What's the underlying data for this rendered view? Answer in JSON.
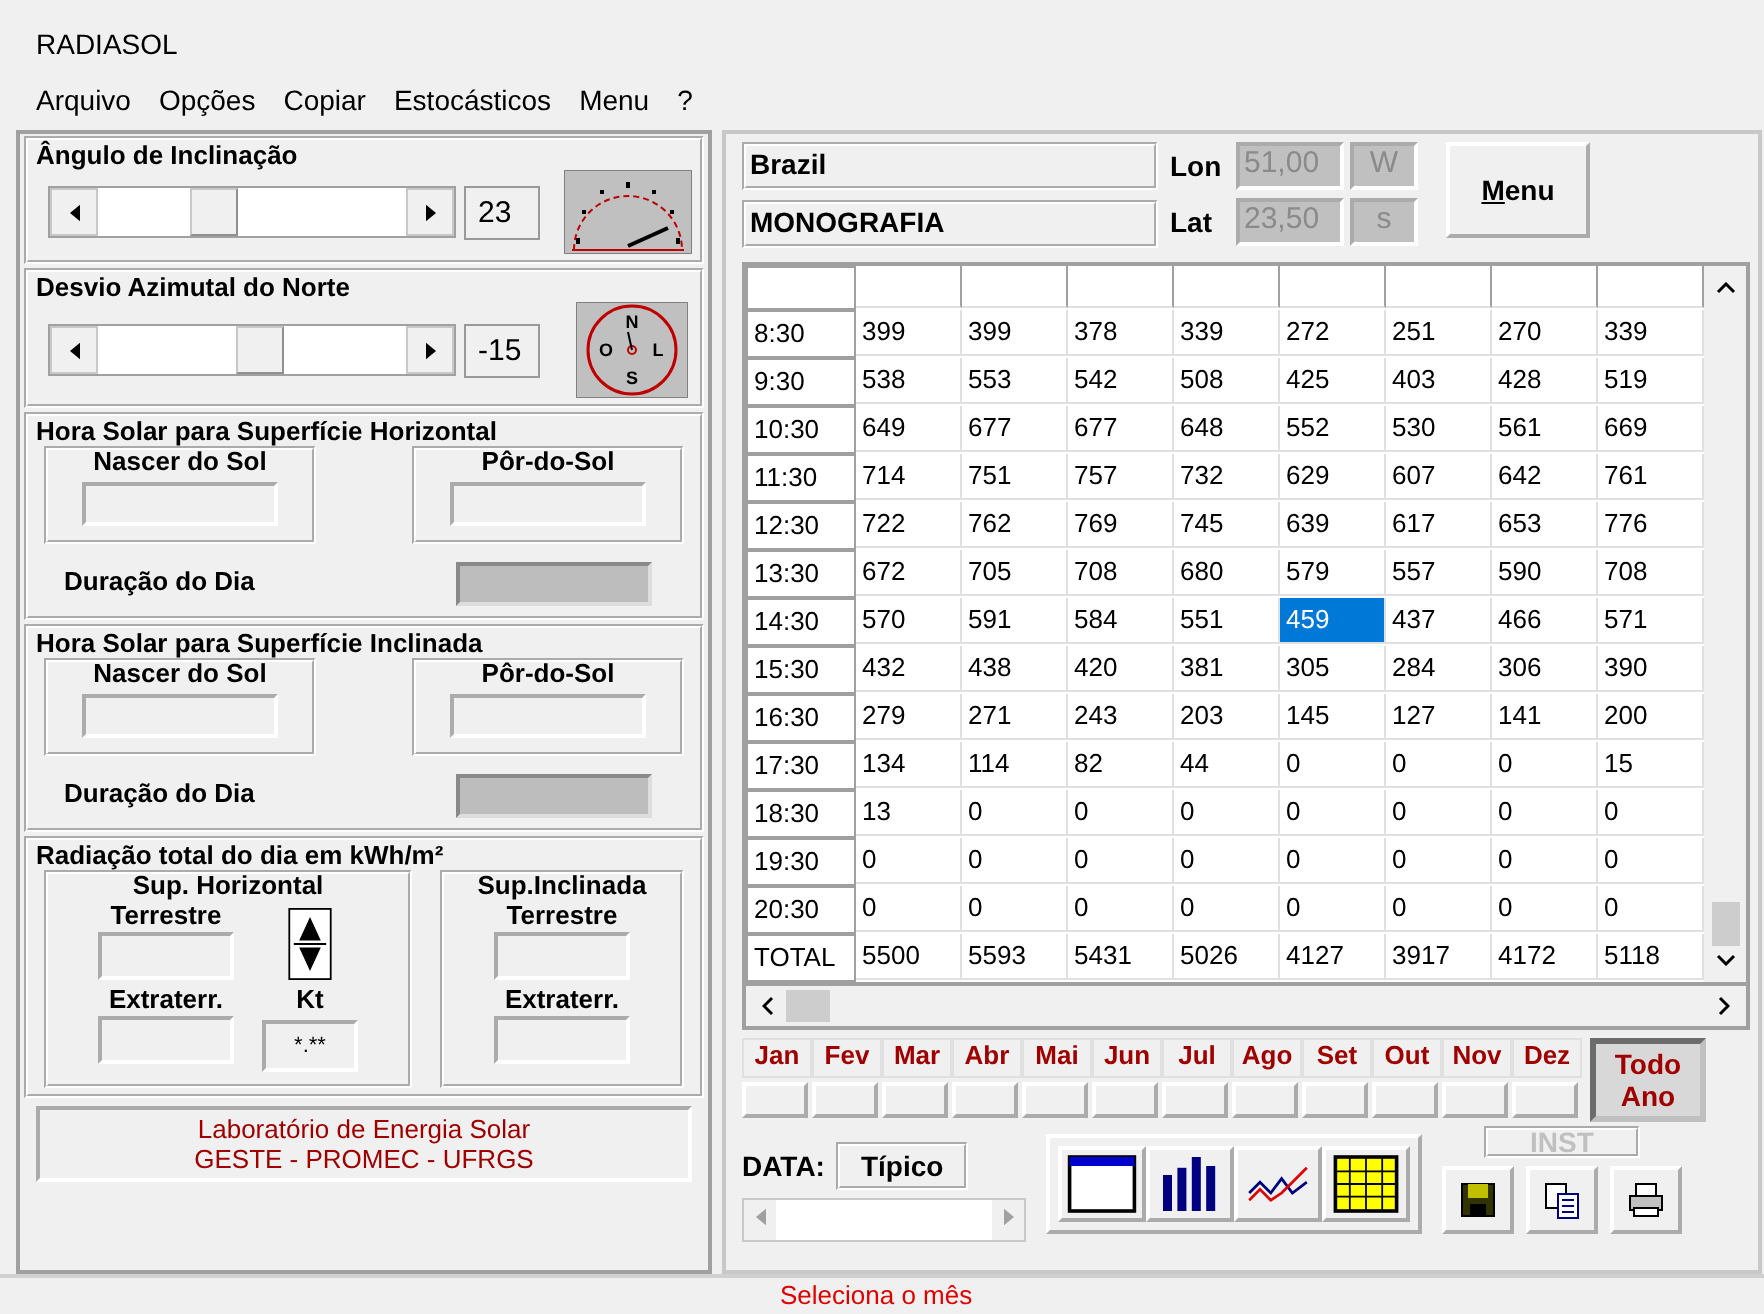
{
  "window": {
    "title": "RADIASOL"
  },
  "menu": [
    "Arquivo",
    "Opções",
    "Copiar",
    "Estocásticos",
    "Menu",
    "?"
  ],
  "tilt": {
    "title": "Ângulo de Inclinação",
    "value": "23"
  },
  "azimuth": {
    "title": "Desvio Azimutal do Norte",
    "value": "-15",
    "compass": [
      "N",
      "L",
      "S",
      "O"
    ]
  },
  "sun_groups": [
    {
      "title": "Hora Solar para Superfície Horizontal",
      "sunrise": "Nascer do Sol",
      "sunset": "Pôr-do-Sol",
      "duration": "Duração do Dia"
    },
    {
      "title": "Hora Solar para Superfície Inclinada",
      "sunrise": "Nascer do Sol",
      "sunset": "Pôr-do-Sol",
      "duration": "Duração do Dia"
    }
  ],
  "radiation": {
    "title": "Radiação total do dia em kWh/m²",
    "horizontal": "Sup. Horizontal",
    "inclined": "Sup.Inclinada",
    "horizontal_terrestrial": "Terrestre",
    "horizontal_extra": "Extraterr.",
    "inclined_terrestrial": "Terrestre",
    "inclined_extra": "Extraterr.",
    "kt_label": "Kt",
    "kt_value": "*.**"
  },
  "footer": [
    "Laboratório de Energia Solar",
    "GESTE - PROMEC - UFRGS"
  ],
  "location": {
    "country": "Brazil",
    "site": "MONOGRAFIA",
    "lon_label": "Lon",
    "lon": "51,00",
    "lon_dir": "W",
    "lat_label": "Lat",
    "lat": "23,50",
    "lat_dir": "s",
    "disabled": true,
    "menu_button": "Menu"
  },
  "table": {
    "rows": [
      {
        "time": "8:30",
        "cells": [
          {
            "v": "399",
            "selected": false
          },
          {
            "v": "399",
            "selected": false
          },
          {
            "v": "378",
            "selected": false
          },
          {
            "v": "339",
            "selected": false
          },
          {
            "v": "272",
            "selected": false
          },
          {
            "v": "251",
            "selected": false
          },
          {
            "v": "270",
            "selected": false
          },
          {
            "v": "339",
            "selected": false
          }
        ]
      },
      {
        "time": "9:30",
        "cells": [
          {
            "v": "538",
            "selected": false
          },
          {
            "v": "553",
            "selected": false
          },
          {
            "v": "542",
            "selected": false
          },
          {
            "v": "508",
            "selected": false
          },
          {
            "v": "425",
            "selected": false
          },
          {
            "v": "403",
            "selected": false
          },
          {
            "v": "428",
            "selected": false
          },
          {
            "v": "519",
            "selected": false
          }
        ]
      },
      {
        "time": "10:30",
        "cells": [
          {
            "v": "649",
            "selected": false
          },
          {
            "v": "677",
            "selected": false
          },
          {
            "v": "677",
            "selected": false
          },
          {
            "v": "648",
            "selected": false
          },
          {
            "v": "552",
            "selected": false
          },
          {
            "v": "530",
            "selected": false
          },
          {
            "v": "561",
            "selected": false
          },
          {
            "v": "669",
            "selected": false
          }
        ]
      },
      {
        "time": "11:30",
        "cells": [
          {
            "v": "714",
            "selected": false
          },
          {
            "v": "751",
            "selected": false
          },
          {
            "v": "757",
            "selected": false
          },
          {
            "v": "732",
            "selected": false
          },
          {
            "v": "629",
            "selected": false
          },
          {
            "v": "607",
            "selected": false
          },
          {
            "v": "642",
            "selected": false
          },
          {
            "v": "761",
            "selected": false
          }
        ]
      },
      {
        "time": "12:30",
        "cells": [
          {
            "v": "722",
            "selected": false
          },
          {
            "v": "762",
            "selected": false
          },
          {
            "v": "769",
            "selected": false
          },
          {
            "v": "745",
            "selected": false
          },
          {
            "v": "639",
            "selected": false
          },
          {
            "v": "617",
            "selected": false
          },
          {
            "v": "653",
            "selected": false
          },
          {
            "v": "776",
            "selected": false
          }
        ]
      },
      {
        "time": "13:30",
        "cells": [
          {
            "v": "672",
            "selected": false
          },
          {
            "v": "705",
            "selected": false
          },
          {
            "v": "708",
            "selected": false
          },
          {
            "v": "680",
            "selected": false
          },
          {
            "v": "579",
            "selected": false
          },
          {
            "v": "557",
            "selected": false
          },
          {
            "v": "590",
            "selected": false
          },
          {
            "v": "708",
            "selected": false
          }
        ]
      },
      {
        "time": "14:30",
        "cells": [
          {
            "v": "570",
            "selected": false
          },
          {
            "v": "591",
            "selected": false
          },
          {
            "v": "584",
            "selected": false
          },
          {
            "v": "551",
            "selected": false
          },
          {
            "v": "459",
            "selected": true
          },
          {
            "v": "437",
            "selected": false
          },
          {
            "v": "466",
            "selected": false
          },
          {
            "v": "571",
            "selected": false
          }
        ]
      },
      {
        "time": "15:30",
        "cells": [
          {
            "v": "432",
            "selected": false
          },
          {
            "v": "438",
            "selected": false
          },
          {
            "v": "420",
            "selected": false
          },
          {
            "v": "381",
            "selected": false
          },
          {
            "v": "305",
            "selected": false
          },
          {
            "v": "284",
            "selected": false
          },
          {
            "v": "306",
            "selected": false
          },
          {
            "v": "390",
            "selected": false
          }
        ]
      },
      {
        "time": "16:30",
        "cells": [
          {
            "v": "279",
            "selected": false
          },
          {
            "v": "271",
            "selected": false
          },
          {
            "v": "243",
            "selected": false
          },
          {
            "v": "203",
            "selected": false
          },
          {
            "v": "145",
            "selected": false
          },
          {
            "v": "127",
            "selected": false
          },
          {
            "v": "141",
            "selected": false
          },
          {
            "v": "200",
            "selected": false
          }
        ]
      },
      {
        "time": "17:30",
        "cells": [
          {
            "v": "134",
            "selected": false
          },
          {
            "v": "114",
            "selected": false
          },
          {
            "v": "82",
            "selected": false
          },
          {
            "v": "44",
            "selected": false
          },
          {
            "v": "0",
            "selected": false
          },
          {
            "v": "0",
            "selected": false
          },
          {
            "v": "0",
            "selected": false
          },
          {
            "v": "15",
            "selected": false
          }
        ]
      },
      {
        "time": "18:30",
        "cells": [
          {
            "v": "13",
            "selected": false
          },
          {
            "v": "0",
            "selected": false
          },
          {
            "v": "0",
            "selected": false
          },
          {
            "v": "0",
            "selected": false
          },
          {
            "v": "0",
            "selected": false
          },
          {
            "v": "0",
            "selected": false
          },
          {
            "v": "0",
            "selected": false
          },
          {
            "v": "0",
            "selected": false
          }
        ]
      },
      {
        "time": "19:30",
        "cells": [
          {
            "v": "0",
            "selected": false
          },
          {
            "v": "0",
            "selected": false
          },
          {
            "v": "0",
            "selected": false
          },
          {
            "v": "0",
            "selected": false
          },
          {
            "v": "0",
            "selected": false
          },
          {
            "v": "0",
            "selected": false
          },
          {
            "v": "0",
            "selected": false
          },
          {
            "v": "0",
            "selected": false
          }
        ]
      },
      {
        "time": "20:30",
        "cells": [
          {
            "v": "0",
            "selected": false
          },
          {
            "v": "0",
            "selected": false
          },
          {
            "v": "0",
            "selected": false
          },
          {
            "v": "0",
            "selected": false
          },
          {
            "v": "0",
            "selected": false
          },
          {
            "v": "0",
            "selected": false
          },
          {
            "v": "0",
            "selected": false
          },
          {
            "v": "0",
            "selected": false
          }
        ]
      },
      {
        "time": "TOTAL",
        "cells": [
          {
            "v": "5500",
            "selected": false
          },
          {
            "v": "5593",
            "selected": false
          },
          {
            "v": "5431",
            "selected": false
          },
          {
            "v": "5026",
            "selected": false
          },
          {
            "v": "4127",
            "selected": false
          },
          {
            "v": "3917",
            "selected": false
          },
          {
            "v": "4172",
            "selected": false
          },
          {
            "v": "5118",
            "selected": false
          }
        ]
      }
    ]
  },
  "months": [
    {
      "label": "Jan",
      "selected": false
    },
    {
      "label": "Fev",
      "selected": false
    },
    {
      "label": "Mar",
      "selected": false
    },
    {
      "label": "Abr",
      "selected": false
    },
    {
      "label": "Mai",
      "selected": false
    },
    {
      "label": "Jun",
      "selected": false
    },
    {
      "label": "Jul",
      "selected": false
    },
    {
      "label": "Ago",
      "selected": false
    },
    {
      "label": "Set",
      "selected": false
    },
    {
      "label": "Out",
      "selected": false
    },
    {
      "label": "Nov",
      "selected": false
    },
    {
      "label": "Dez",
      "selected": false
    }
  ],
  "whole_year": {
    "label": "Todo Ano",
    "selected": true
  },
  "data_selector": {
    "label": "DATA:",
    "value": "Típico"
  },
  "inst_button": {
    "label": "INST",
    "disabled": true
  },
  "status_bar": "Seleciona o mês"
}
